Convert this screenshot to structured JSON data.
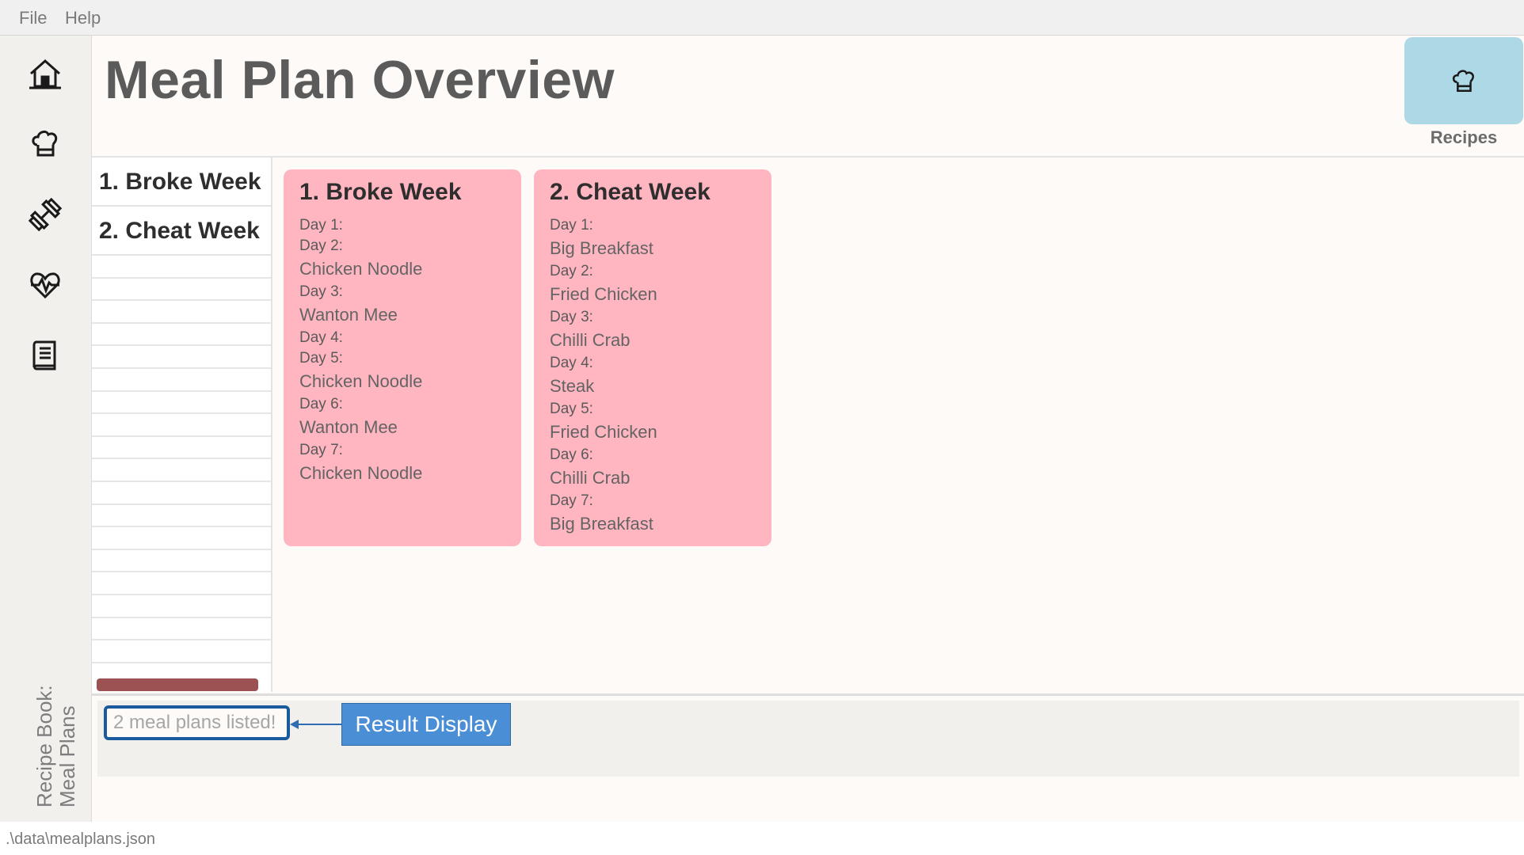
{
  "menu": {
    "items": [
      "File",
      "Help"
    ]
  },
  "sidebar": {
    "icons": [
      "home-icon",
      "chef-hat-icon",
      "dumbbell-icon",
      "heartbeat-icon",
      "book-icon"
    ],
    "label_line1": "Recipe Book:",
    "label_line2": "Meal Plans"
  },
  "header": {
    "title": "Meal Plan Overview",
    "recipes_button": {
      "icon": "chef-hat-icon",
      "label": "Recipes"
    }
  },
  "colors": {
    "card": "#ffb6c1",
    "recipes_button": "#add8e6",
    "scroll_thumb": "#9c5252",
    "callout": "#4a8ed6"
  },
  "list": {
    "items": [
      {
        "label": "1.  Broke Week"
      },
      {
        "label": "2.  Cheat Week"
      }
    ],
    "empty_rows": 18
  },
  "cards": [
    {
      "title": "1.  Broke Week",
      "days": [
        {
          "label": "Day 1:",
          "meal": ""
        },
        {
          "label": "Day 2:",
          "meal": "Chicken Noodle"
        },
        {
          "label": "Day 3:",
          "meal": "Wanton Mee"
        },
        {
          "label": "Day 4:",
          "meal": ""
        },
        {
          "label": "Day 5:",
          "meal": "Chicken Noodle"
        },
        {
          "label": "Day 6:",
          "meal": "Wanton Mee"
        },
        {
          "label": "Day 7:",
          "meal": "Chicken Noodle"
        }
      ]
    },
    {
      "title": "2.  Cheat Week",
      "days": [
        {
          "label": "Day 1:",
          "meal": "Big Breakfast"
        },
        {
          "label": "Day 2:",
          "meal": "Fried Chicken"
        },
        {
          "label": "Day 3:",
          "meal": "Chilli Crab"
        },
        {
          "label": "Day 4:",
          "meal": "Steak"
        },
        {
          "label": "Day 5:",
          "meal": "Fried Chicken"
        },
        {
          "label": "Day 6:",
          "meal": "Chilli Crab"
        },
        {
          "label": "Day 7:",
          "meal": "Big Breakfast"
        }
      ]
    }
  ],
  "result": {
    "text": "2 meal plans listed!",
    "callout_label": "Result Display"
  },
  "status": {
    "path": ".\\data\\mealplans.json"
  }
}
